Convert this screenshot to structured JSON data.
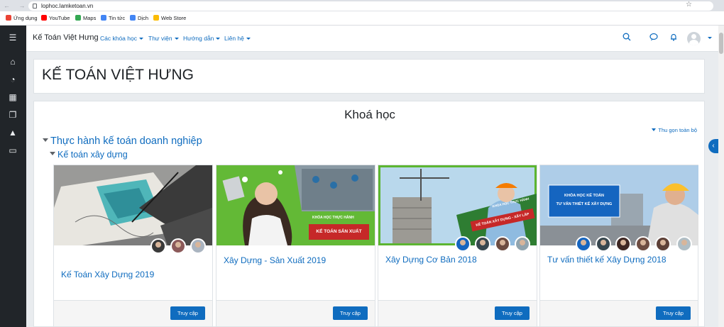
{
  "browser": {
    "url": "lophoc.lamketoan.vn",
    "nav_glyphs": "← → C",
    "bookmarks": [
      {
        "label": "Ứng dụng",
        "color": "#ea4335"
      },
      {
        "label": "YouTube",
        "color": "#ff0000"
      },
      {
        "label": "Maps",
        "color": "#34a853"
      },
      {
        "label": "Tin tức",
        "color": "#4285f4"
      },
      {
        "label": "Dịch",
        "color": "#4285f4"
      },
      {
        "label": "Web Store",
        "color": "#fbbc05"
      }
    ]
  },
  "sidebar": {
    "icons": [
      "menu-icon",
      "home-icon",
      "dashboard-icon",
      "calendar-icon",
      "files-icon",
      "graduation-cap-icon",
      "folder-icon"
    ]
  },
  "navbar": {
    "brand": "Kế Toán Việt Hưng",
    "menus": [
      "Các khóa học",
      "Thư viện",
      "Hướng dẫn",
      "Liên hệ"
    ]
  },
  "page": {
    "heading": "KẾ TOÁN VIỆT HƯNG",
    "section_title": "Khoá học",
    "collapse_all": "Thu gọn toàn bộ",
    "category": "Thực hành kế toán doanh nghiệp",
    "subcategory": "Kế toán xây dựng"
  },
  "courses": [
    {
      "title": "Kế Toán Xây Dựng 2019",
      "button": "Truy cập"
    },
    {
      "title": "Xây Dựng - Sản Xuất 2019",
      "button": "Truy cập",
      "banner_lines": [
        "KHÓA HỌC THỰC HÀNH",
        "KẾ TOÁN SẢN XUẤT"
      ]
    },
    {
      "title": "Xây Dựng Cơ Bản 2018",
      "button": "Truy cập",
      "banner_lines": [
        "KHÓA HỌC THỰC HÀNH",
        "KẾ TOÁN XÂY DỰNG - XÂY LẮP"
      ]
    },
    {
      "title": "Tư vấn thiết kế Xây Dựng 2018",
      "button": "Truy cập",
      "banner_lines": [
        "KHÓA HỌC KẾ TOÁN",
        "TƯ VẤN THIẾT KẾ XÂY DỰNG"
      ]
    }
  ],
  "colors": {
    "accent": "#0f6cbf",
    "sidebar": "#212529",
    "green": "#5cb531"
  }
}
